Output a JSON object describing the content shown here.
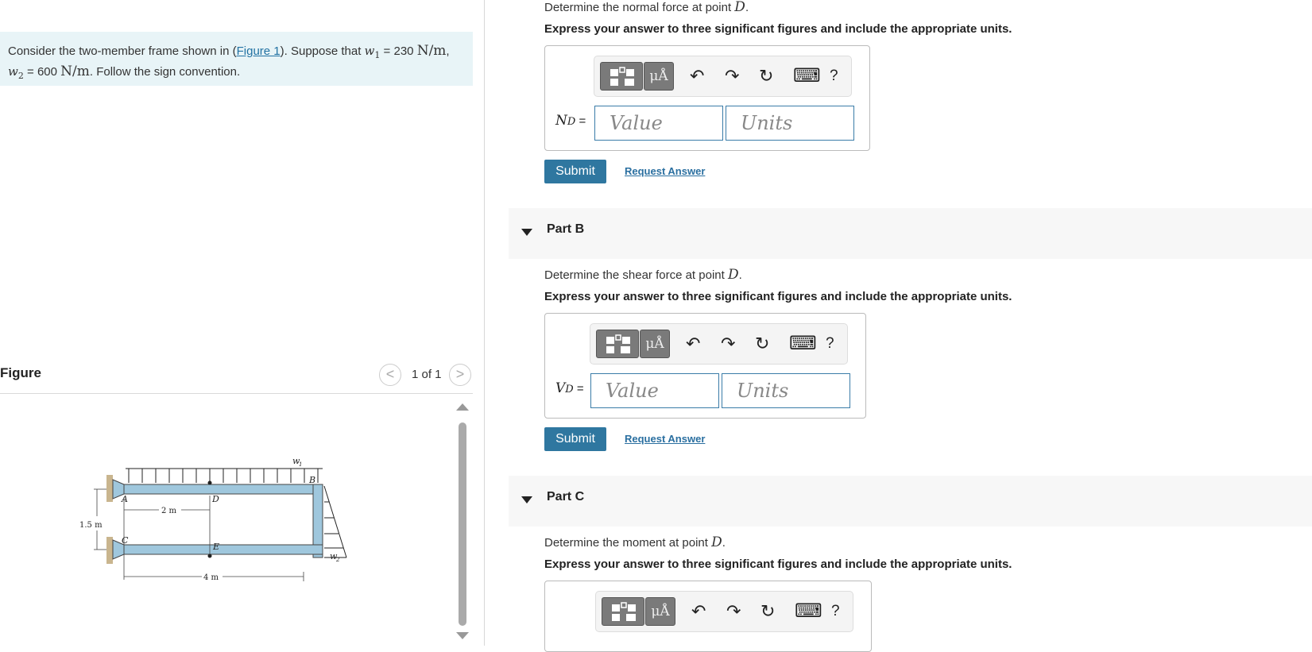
{
  "problem": {
    "intro": "Consider the two-member frame shown in (",
    "figure_link": "Figure 1",
    "mid1": "). Suppose that ",
    "w1_sym": "w",
    "w1_sub": "1",
    "w1_eq": " = 230 ",
    "w1_unit": "N/m",
    "sep": ",",
    "w2_sym": "w",
    "w2_sub": "2",
    "w2_eq": " = 600 ",
    "w2_unit": "N/m",
    "tail": ". Follow the sign convention."
  },
  "figure": {
    "title": "Figure",
    "count": "1 of 1",
    "prev_glyph": "<",
    "next_glyph": ">",
    "labels": {
      "A": "A",
      "B": "B",
      "C": "C",
      "D": "D",
      "E": "E",
      "w1": "w",
      "w1_sub": "1",
      "w2": "w",
      "w2_sub": "2",
      "dim_2m": "2 m",
      "dim_4m": "4 m",
      "dim_15m": "1.5 m"
    }
  },
  "toolbar": {
    "mu_label": "μÅ",
    "undo": "↶",
    "redo": "↷",
    "reset": "↻",
    "keyboard": "⌨",
    "help": "?"
  },
  "partA": {
    "question_prefix": "Determine the normal force at point ",
    "point": "D",
    "question_suffix": ".",
    "instruction": "Express your answer to three significant figures and include the appropriate units.",
    "var_sym": "N",
    "var_sub": "D",
    "eq": " =",
    "value_placeholder": "Value",
    "units_placeholder": "Units",
    "submit": "Submit",
    "request": "Request Answer"
  },
  "partB": {
    "title": "Part B",
    "question_prefix": "Determine the shear force at point ",
    "point": "D",
    "question_suffix": ".",
    "instruction": "Express your answer to three significant figures and include the appropriate units.",
    "var_sym": "V",
    "var_sub": "D",
    "eq": " =",
    "value_placeholder": "Value",
    "units_placeholder": "Units",
    "submit": "Submit",
    "request": "Request Answer"
  },
  "partC": {
    "title": "Part C",
    "question_prefix": "Determine the moment at point ",
    "point": "D",
    "question_suffix": ".",
    "instruction": "Express your answer to three significant figures and include the appropriate units."
  }
}
